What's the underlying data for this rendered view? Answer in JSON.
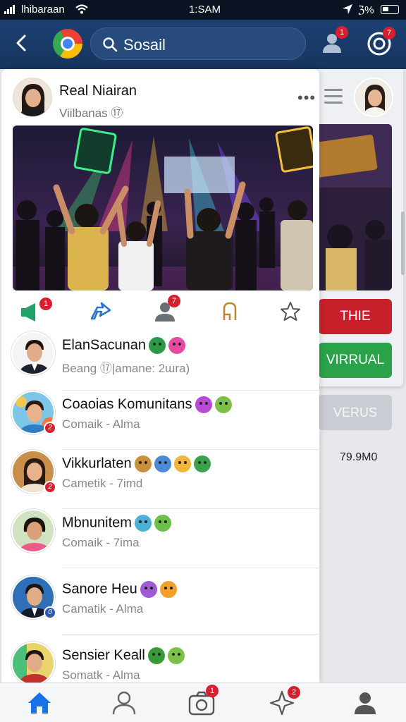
{
  "status_bar": {
    "carrier": "lhibaraan",
    "time": "1:SAM",
    "battery": "ℨ%"
  },
  "appbar": {
    "search_query": "Sosail",
    "person_badge": "1",
    "target_badge": "7"
  },
  "background_panel": {
    "button_red": "THIE",
    "button_green": "VIRRUAL",
    "button_gray": "VERUS",
    "stat": "79.9M0"
  },
  "post": {
    "author": "Real Niairan",
    "subtitle": "Viilbanas ⑰",
    "more": "•••"
  },
  "actions": {
    "megaphone_badge": "1",
    "person_badge": "7"
  },
  "friends": [
    {
      "name": "ElanSacunan",
      "sub": "Beang ⑰|amane: 2ɯra)",
      "badge": ""
    },
    {
      "name": "Coaoias Komunitans",
      "sub": "Comaik - Alma",
      "badge": "2"
    },
    {
      "name": "Vikkurlaten",
      "sub": "Cametik - 7imd",
      "badge": "2"
    },
    {
      "name": "Mbnunitem",
      "sub": "Comaik - 7ima",
      "badge": ""
    },
    {
      "name": "Sanore Heu",
      "sub": "Camatik - Alma",
      "badge": "0"
    },
    {
      "name": "Sensier Keall",
      "sub": "Somatk - Alma",
      "badge": ""
    }
  ],
  "bottom_nav": {
    "camera_badge": "1",
    "star_badge": "2"
  },
  "colors": {
    "appbar": "#1c4173",
    "nav_active": "#1a73e8",
    "badge": "#d6202e",
    "red_button": "#c8202a",
    "green_button": "#2aa24a"
  }
}
